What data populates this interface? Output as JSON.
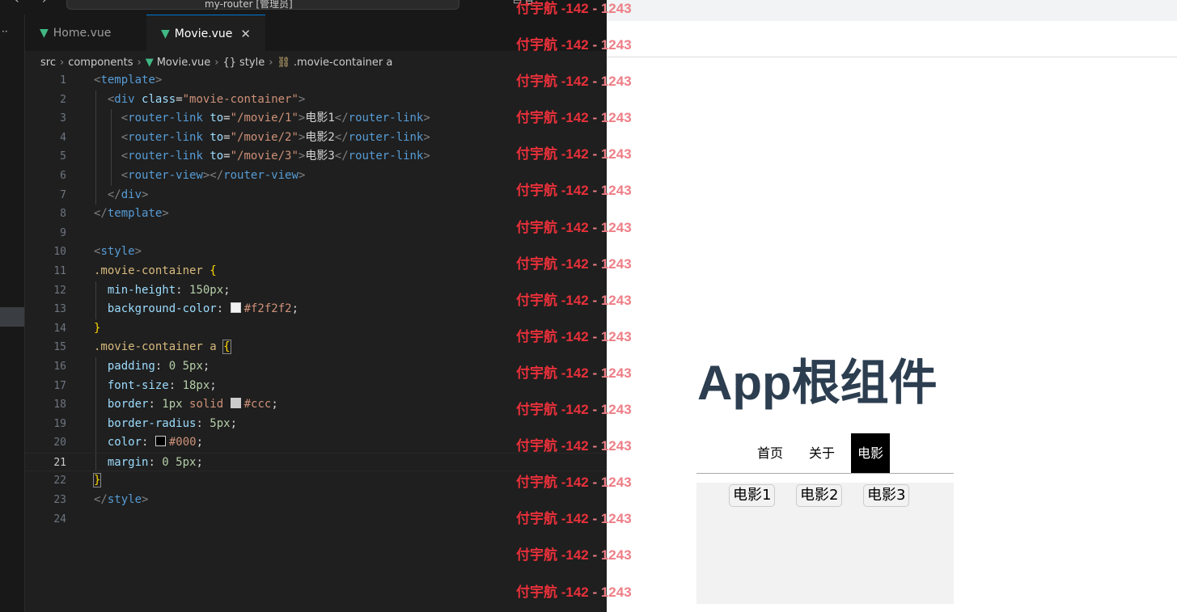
{
  "titlebar": {
    "nav_arrows": "‹ ›",
    "command_center": "my-router [管理员]",
    "window_controls": "▭ ⊟"
  },
  "activitybar": {
    "dots": "··"
  },
  "tabs": [
    {
      "label": "Home.vue",
      "icon": "vue-icon",
      "active": false
    },
    {
      "label": "Movie.vue",
      "icon": "vue-icon",
      "active": true,
      "close": "✕"
    }
  ],
  "breadcrumb": {
    "src": "src",
    "components": "components",
    "file": "Movie.vue",
    "style": "style",
    "selector": ".movie-container a",
    "sep": "›"
  },
  "code": {
    "line_numbers": [
      "1",
      "2",
      "3",
      "4",
      "5",
      "6",
      "7",
      "8",
      "9",
      "10",
      "11",
      "12",
      "13",
      "14",
      "15",
      "16",
      "17",
      "18",
      "19",
      "20",
      "21",
      "22",
      "23",
      "24"
    ],
    "current_line": "21",
    "l1": {
      "open": "<",
      "tag": "template",
      "close": ">"
    },
    "l2": {
      "open": "<",
      "tag": "div",
      "attr": "class",
      "eq": "=",
      "val": "\"movie-container\"",
      "close": ">"
    },
    "links": [
      {
        "open": "<",
        "tag": "router-link",
        "attr": "to",
        "eq": "=",
        "val": "\"/movie/1\"",
        "close": ">",
        "text": "电影1",
        "end_open": "</",
        "end_tag": "router-link",
        "end_close": ">"
      },
      {
        "open": "<",
        "tag": "router-link",
        "attr": "to",
        "eq": "=",
        "val": "\"/movie/2\"",
        "close": ">",
        "text": "电影2",
        "end_open": "</",
        "end_tag": "router-link",
        "end_close": ">"
      },
      {
        "open": "<",
        "tag": "router-link",
        "attr": "to",
        "eq": "=",
        "val": "\"/movie/3\"",
        "close": ">",
        "text": "电影3",
        "end_open": "</",
        "end_tag": "router-link",
        "end_close": ">"
      }
    ],
    "l6": {
      "open": "<",
      "tag": "router-view",
      "mid": "></",
      "tag2": "router-view",
      "close": ">"
    },
    "l7": {
      "open": "</",
      "tag": "div",
      "close": ">"
    },
    "l8": {
      "open": "</",
      "tag": "template",
      "close": ">"
    },
    "l10": {
      "open": "<",
      "tag": "style",
      "close": ">"
    },
    "l11": {
      "selector": ".movie-container ",
      "brace": "{"
    },
    "l12": {
      "prop": "min-height",
      "colon": ": ",
      "num": "150px",
      "semi": ";"
    },
    "l13": {
      "prop": "background-color",
      "colon": ": ",
      "swatch": "#f2f2f2",
      "val": "#f2f2f2",
      "semi": ";"
    },
    "l14": {
      "brace": "}"
    },
    "l15": {
      "selector": ".movie-container a ",
      "brace": "{"
    },
    "l16": {
      "prop": "padding",
      "colon": ": ",
      "num": "0 5px",
      "semi": ";"
    },
    "l17": {
      "prop": "font-size",
      "colon": ": ",
      "num": "18px",
      "semi": ";"
    },
    "l18": {
      "prop": "border",
      "colon": ": ",
      "num": "1px",
      "kw": " solid ",
      "swatch": "#cccccc",
      "val": "#ccc",
      "semi": ";"
    },
    "l19": {
      "prop": "border-radius",
      "colon": ": ",
      "num": "5px",
      "semi": ";"
    },
    "l20": {
      "prop": "color",
      "colon": ": ",
      "swatch": "#000000",
      "val": "#000",
      "semi": ";"
    },
    "l21": {
      "prop": "margin",
      "colon": ": ",
      "num": "0 5px",
      "semi": ";"
    },
    "l22": {
      "brace": "}"
    },
    "l23": {
      "open": "</",
      "tag": "style",
      "close": ">"
    }
  },
  "preview": {
    "title": "App根组件",
    "nav": [
      {
        "label": "首页",
        "active": false
      },
      {
        "label": "关于",
        "active": false
      },
      {
        "label": "电影",
        "active": true
      }
    ],
    "movie_links": [
      "电影1",
      "电影2",
      "电影3"
    ]
  },
  "watermark": {
    "part_a": "付宇航 -142",
    "part_b": " - 1243",
    "rows": 17
  },
  "colors": {
    "editor_bg": "#1f1f1f",
    "vue_green": "#41b883",
    "title_color": "#2c3e50",
    "watermark_red": "#e8303a"
  }
}
